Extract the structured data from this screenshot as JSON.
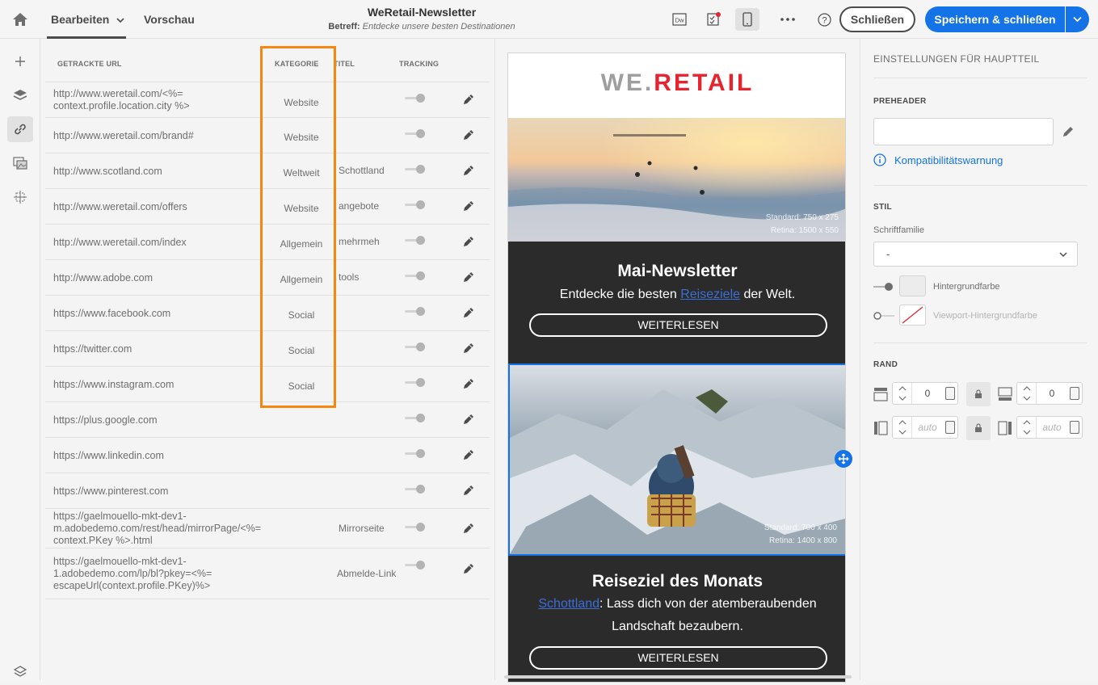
{
  "header": {
    "tab_edit": "Bearbeiten",
    "tab_preview": "Vorschau",
    "title": "WeRetail-Newsletter",
    "subject_label": "Betreff:",
    "subject_value": "Entdecke unsere besten Destinationen",
    "close_label": "Schließen",
    "save_label": "Speichern & schließen",
    "dw_label": "Dw"
  },
  "links_table": {
    "columns": [
      "GETRACKTE URL",
      "KATEGORIE",
      "TITEL",
      "TRACKING"
    ],
    "rows": [
      {
        "url": "http://www.weretail.com/<%= context.profile.location.city %>",
        "category": "Website",
        "title": "",
        "tracking": true
      },
      {
        "url": "http://www.weretail.com/brand#",
        "category": "Website",
        "title": "",
        "tracking": true
      },
      {
        "url": "http://www.scotland.com",
        "category": "Weltweit",
        "title": "Schottland",
        "tracking": true
      },
      {
        "url": "http://www.weretail.com/offers",
        "category": "Website",
        "title": "angebote",
        "tracking": true
      },
      {
        "url": "http://www.weretail.com/index",
        "category": "Allgemein",
        "title": "mehrmeh",
        "tracking": true
      },
      {
        "url": "http://www.adobe.com",
        "category": "Allgemein",
        "title": "tools",
        "tracking": true
      },
      {
        "url": "https://www.facebook.com",
        "category": "Social",
        "title": "",
        "tracking": true
      },
      {
        "url": "https://twitter.com",
        "category": "Social",
        "title": "",
        "tracking": true
      },
      {
        "url": "https://www.instagram.com",
        "category": "Social",
        "title": "",
        "tracking": true
      },
      {
        "url": "https://plus.google.com",
        "category": "",
        "title": "",
        "tracking": true
      },
      {
        "url": "https://www.linkedin.com",
        "category": "",
        "title": "",
        "tracking": true
      },
      {
        "url": "https://www.pinterest.com",
        "category": "",
        "title": "",
        "tracking": true
      },
      {
        "url": "https://gaelmouello-mkt-dev1-m.adobedemo.com/rest/head/mirrorPage/<%= context.PKey %>.html",
        "category": "",
        "title": "Mirrorseite",
        "tracking": true
      },
      {
        "url": "https://gaelmouello-mkt-dev1-1.adobedemo.com/lp/bl?pkey=<%= escapeUrl(context.profile.PKey)%>",
        "category": "",
        "title": "Abmelde-Link",
        "tracking": true
      }
    ]
  },
  "email": {
    "logo_we": "WE.",
    "logo_retail": "RETAIL",
    "hero1_caption_1": "Standard: 750 x 275",
    "hero1_caption_2": "Retina: 1500 x 550",
    "block1_title": "Mai-Newsletter",
    "block1_text_before": "Entdecke die besten ",
    "block1_text_link": "Reiseziele",
    "block1_text_after": " der Welt.",
    "block1_button": "WEITERLESEN",
    "hero2_caption_1": "Standard: 700 x 400",
    "hero2_caption_2": "Retina: 1400 x 800",
    "block2_title": "Reiseziel des Monats",
    "block2_text_link": "Schottland",
    "block2_text_after": ": Lass dich von der atemberaubenden Landschaft bezaubern.",
    "block2_button": "WEITERLESEN"
  },
  "settings": {
    "heading": "EINSTELLUNGEN FÜR HAUPTTEIL",
    "preheader_label": "PREHEADER",
    "preheader_value": "",
    "compat_warning": "Kompatibilitätswarnung",
    "style_label": "STIL",
    "font_family_label": "Schriftfamilie",
    "font_family_value": "-",
    "bg_color_label": "Hintergrundfarbe",
    "viewport_bg_label": "Viewport-Hintergrundfarbe",
    "margin_label": "RAND",
    "margin_top": "0",
    "margin_bottom": "0",
    "margin_left_placeholder": "auto",
    "margin_right_placeholder": "auto"
  },
  "colors": {
    "accent": "#1473e6",
    "highlight": "#f68511",
    "brand_red": "#e6242f",
    "dark_block": "#2b2b2b"
  },
  "icons": [
    "home-icon",
    "chevron-down-icon",
    "dw-icon",
    "checklist-icon",
    "mobile-icon",
    "more-icon",
    "help-icon",
    "plus-icon",
    "layers-icon",
    "link-icon",
    "image-icon",
    "fragments-icon",
    "settings-layers-icon",
    "pencil-icon",
    "info-icon",
    "lock-icon",
    "move-icon"
  ]
}
